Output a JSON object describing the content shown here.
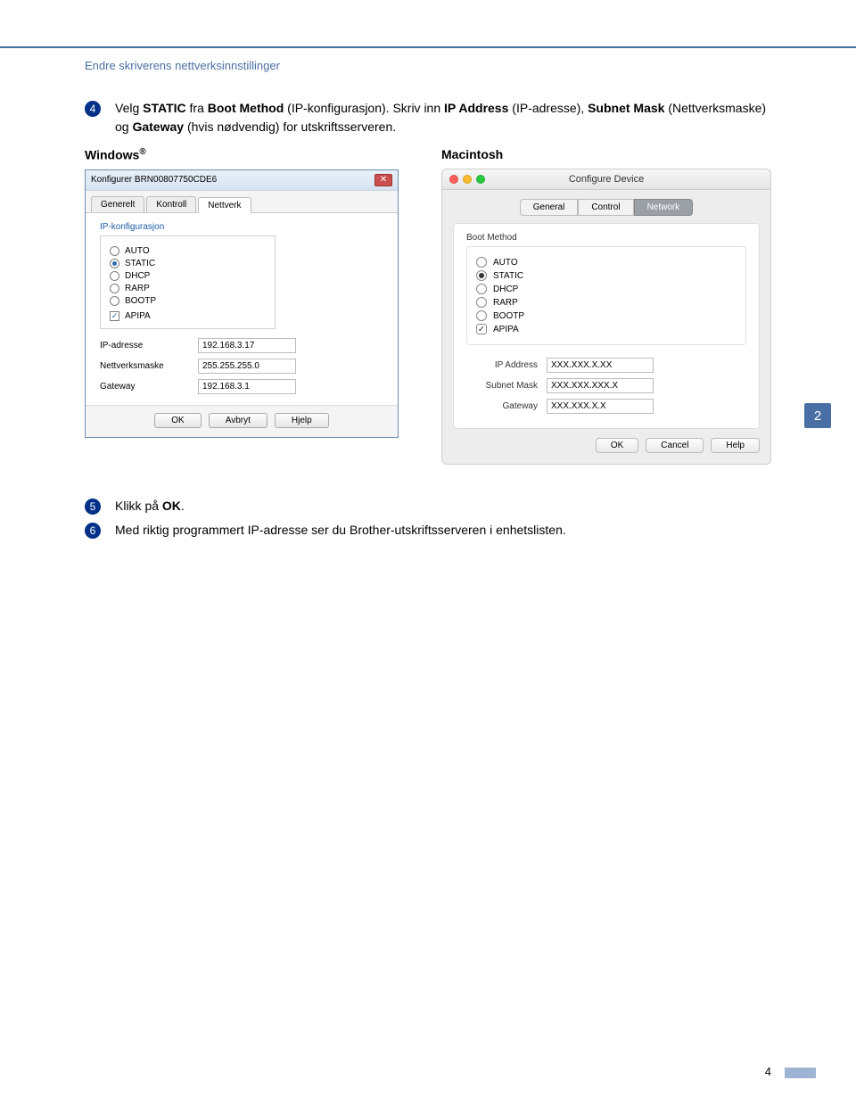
{
  "header": {
    "section_title": "Endre skriverens nettverksinnstillinger"
  },
  "steps": {
    "s4": {
      "num": "4",
      "pre": "Velg ",
      "bold1": "STATIC",
      "mid1": " fra ",
      "bold2": "Boot Method",
      "post1": " (IP-konfigurasjon). Skriv inn ",
      "bold3": "IP Address",
      "mid2": " (IP-adresse), ",
      "bold4": "Subnet Mask",
      "mid3": " (Nettverksmaske) og ",
      "bold5": "Gateway",
      "post2": " (hvis nødvendig) for utskriftsserveren."
    },
    "s5": {
      "num": "5",
      "pre": "Klikk på ",
      "bold1": "OK",
      "post": "."
    },
    "s6": {
      "num": "6",
      "text": "Med riktig programmert IP-adresse ser du Brother-utskriftsserveren i enhetslisten."
    }
  },
  "labels": {
    "windows": "Windows",
    "macintosh": "Macintosh"
  },
  "side_tab": "2",
  "page_number": "4",
  "windows_dialog": {
    "title": "Konfigurer BRN00807750CDE6",
    "tabs": [
      "Generelt",
      "Kontroll",
      "Nettverk"
    ],
    "group_label": "IP-konfigurasjon",
    "options": [
      "AUTO",
      "STATIC",
      "DHCP",
      "RARP",
      "BOOTP"
    ],
    "apipa": "APIPA",
    "fields": {
      "ip_label": "IP-adresse",
      "ip_value": "192.168.3.17",
      "mask_label": "Nettverksmaske",
      "mask_value": "255.255.255.0",
      "gw_label": "Gateway",
      "gw_value": "192.168.3.1"
    },
    "buttons": [
      "OK",
      "Avbryt",
      "Hjelp"
    ]
  },
  "mac_dialog": {
    "title": "Configure Device",
    "tabs": [
      "General",
      "Control",
      "Network"
    ],
    "group_label": "Boot Method",
    "options": [
      "AUTO",
      "STATIC",
      "DHCP",
      "RARP",
      "BOOTP"
    ],
    "apipa": "APIPA",
    "fields": {
      "ip_label": "IP Address",
      "ip_value": "XXX.XXX.X.XX",
      "mask_label": "Subnet Mask",
      "mask_value": "XXX.XXX.XXX.X",
      "gw_label": "Gateway",
      "gw_value": "XXX.XXX.X.X"
    },
    "buttons": [
      "OK",
      "Cancel",
      "Help"
    ]
  }
}
